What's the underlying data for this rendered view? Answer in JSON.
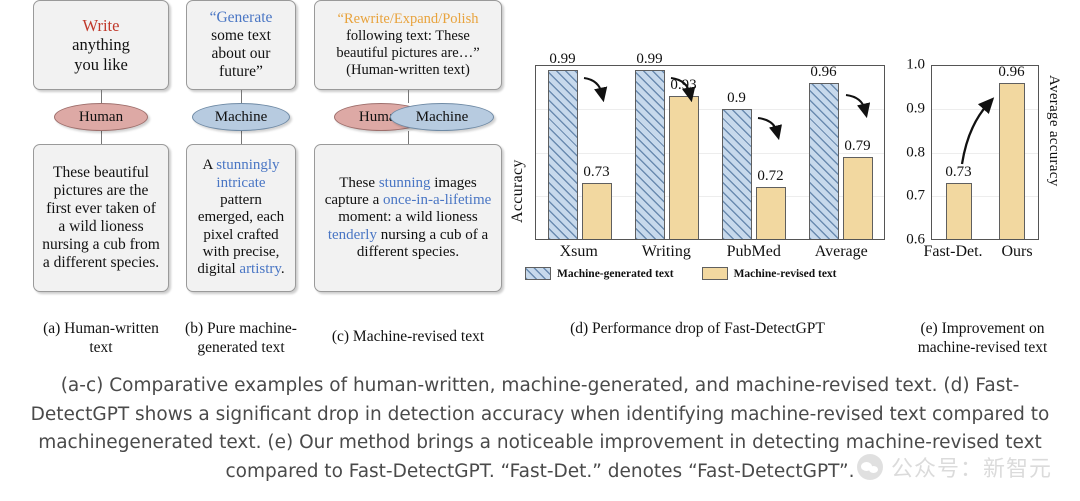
{
  "panels": [
    {
      "id": "a",
      "prompt_lines": [
        {
          "text": "Write",
          "color": "red"
        },
        {
          "text": "anything",
          "color": "black"
        },
        {
          "text": "you like",
          "color": "black"
        }
      ],
      "actors": [
        "Human"
      ],
      "output": "These beautiful pictures are the first ever taken of a wild lioness nursing a cub from a different species.",
      "caption": "(a) Human-written text"
    },
    {
      "id": "b",
      "prompt_lines": [
        {
          "text": "“Generate",
          "color": "blue"
        },
        {
          "text": "some text",
          "color": "black"
        },
        {
          "text": "about our",
          "color": "black"
        },
        {
          "text": "future”",
          "color": "black"
        }
      ],
      "actors": [
        "Machine"
      ],
      "output": "A stunningly intricate pattern emerged, each pixel crafted with precise, digital artistry.",
      "caption": "(b) Pure machine-generated text"
    },
    {
      "id": "c",
      "prompt_lines": [
        {
          "text": "“Rewrite/Expand/Polish",
          "color": "orange"
        },
        {
          "text": "following text: These",
          "color": "black"
        },
        {
          "text": "beautiful pictures are…”",
          "color": "black"
        },
        {
          "text": "(Human-written text)",
          "color": "black"
        }
      ],
      "actors": [
        "Human",
        "Machine"
      ],
      "output": "These stunning images capture a once-in-a-lifetime moment: a wild lioness tenderly nursing a cub of a different species.",
      "caption": "(c) Machine-revised text"
    }
  ],
  "chart_data": [
    {
      "type": "bar",
      "panel_id": "d",
      "caption": "(d) Performance drop of Fast-DetectGPT",
      "title": "",
      "xlabel": "",
      "ylabel": "Accuracy",
      "ylim": [
        0.6,
        1.0
      ],
      "yticks": [],
      "grid": true,
      "legend_position": "bottom",
      "categories": [
        "Xsum",
        "Writing",
        "PubMed",
        "Average"
      ],
      "series": [
        {
          "name": "Machine-generated text",
          "color": "#c7d9ec",
          "hatch": "diagonal",
          "values": [
            0.99,
            0.99,
            0.9,
            0.96
          ]
        },
        {
          "name": "Machine-revised text",
          "color": "#f2d8a0",
          "hatch": "none",
          "values": [
            0.73,
            0.93,
            0.72,
            0.79
          ]
        }
      ],
      "annotations": [
        "drop-arrow",
        "drop-arrow",
        "drop-arrow",
        "drop-arrow"
      ]
    },
    {
      "type": "bar",
      "panel_id": "e",
      "caption": "(e) Improvement on machine-revised text",
      "title": "",
      "xlabel": "",
      "ylabel": "Average accuracy",
      "ylim": [
        0.6,
        1.0
      ],
      "yticks": [
        "1.0",
        "0.9",
        "0.8",
        "0.7",
        "0.6"
      ],
      "grid": true,
      "legend_position": "none",
      "categories": [
        "Fast-Det.",
        "Ours"
      ],
      "values": [
        0.73,
        0.96
      ],
      "series": [
        {
          "name": "Average accuracy",
          "color": "#f2d8a0",
          "hatch": "none",
          "values": [
            0.73,
            0.96
          ]
        }
      ],
      "annotations": [
        "improvement-arrow"
      ]
    }
  ],
  "caption": {
    "text": "(a-c) Comparative examples of human-written, machine-generated, and machine-revised text. (d) Fast-DetectGPT shows a significant drop in detection accuracy when identifying machine-revised text compared to machinegenerated text. (e) Our method brings a noticeable improvement in detecting machine-revised text compared to Fast-DetectGPT. “Fast-Det.” denotes “Fast-DetectGPT”."
  },
  "watermark": {
    "text": "公众号：新智元"
  }
}
